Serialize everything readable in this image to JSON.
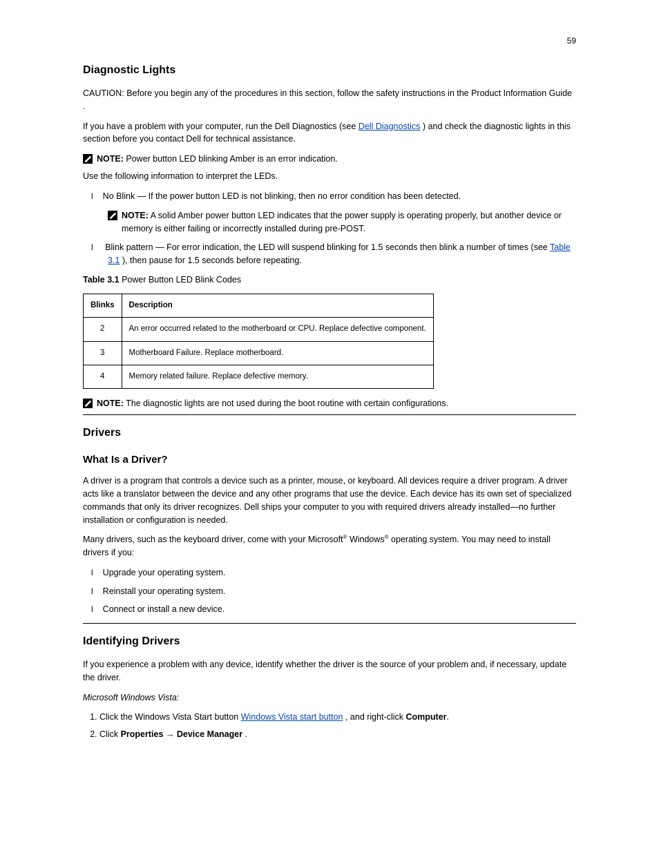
{
  "pageNumber": "59",
  "heading": "Diagnostic Lights",
  "caution_prefix": "CAUTION: Before you begin any of the procedures in this section, follow the safety instructions in the ",
  "caution_emph": "Product Information Guide",
  "caution_suffix": ".",
  "intro": "If you have a problem with your computer, run the Dell Diagnostics (see ",
  "intro_link": "Dell Diagnostics",
  "intro_tail": ") and check the diagnostic lights in this section before you contact Dell for technical assistance.",
  "note1_label": "NOTE:",
  "note1_text": " Power button LED blinking Amber is an error indication.",
  "list_pre": "Use the following information to interpret the LEDs.",
  "li1": "No Blink — If the power button LED is not blinking, then no error condition has been detected.",
  "nested_note_label": "NOTE:",
  "nested_note_text": " A solid Amber power button LED indicates that the power supply is operating properly, but another device or memory is either failing or incorrectly installed during pre-POST.",
  "li2_prefix": "Blink pattern — For error indication, the LED will suspend blinking for 1.5 seconds then blink a number of times (see ",
  "li2_link": "Table 3.1",
  "li2_suffix": "), then pause for 1.5 seconds before repeating.",
  "table_title_label": "Table 3.1",
  "table_title_text": "    Power Button LED Blink Codes",
  "thead_blinks": "Blinks",
  "thead_desc": "Description",
  "row1_blinks": "2",
  "row1_desc": "An error occurred related to the motherboard or CPU. Replace defective component.",
  "row2_blinks": "3",
  "row2_desc": "Motherboard Failure. Replace motherboard.",
  "row3_blinks": "4",
  "row3_desc": "Memory related failure. Replace defective memory.",
  "note2_label": "NOTE:",
  "note2_text": " The diagnostic lights are not used during the boot routine with certain configurations.",
  "drivers_heading": "Drivers",
  "driver_q": "What Is a Driver?",
  "driver_p1a": "A driver is a program that controls a device such as a printer, mouse, or keyboard. All devices require a driver program. A driver acts like a translator between the device and any other programs that use the device. Each device has its own set of specialized commands that only its driver recognizes. Dell ships your computer to you with required drivers already installed—no further installation or configuration is needed.",
  "driver_p1b": "Many drivers, such as the keyboard driver, come with your Microsoft",
  "driver_p1c": " Windows",
  "driver_p1d": " operating system. You may need to install drivers if you:",
  "dl1": "Upgrade your operating system.",
  "dl2": "Reinstall your operating system.",
  "dl3": "Connect or install a new device.",
  "ident_h": "Identifying Drivers",
  "ident_p": "If you experience a problem with any device, identify whether the driver is the source of your problem and, if necessary, update the driver.",
  "win_q1": "Microsoft Windows Vista:",
  "step1_prefix": "Click the Windows Vista Start button ",
  "step1_link": "Windows Vista start button",
  "step1_tail": " , and right-click ",
  "step1_computer": "Computer",
  "step2_a": "Click ",
  "step2_b": "Properties",
  "step2_c": "→ ",
  "step2_d": "Device Manager",
  "step2_e": "."
}
